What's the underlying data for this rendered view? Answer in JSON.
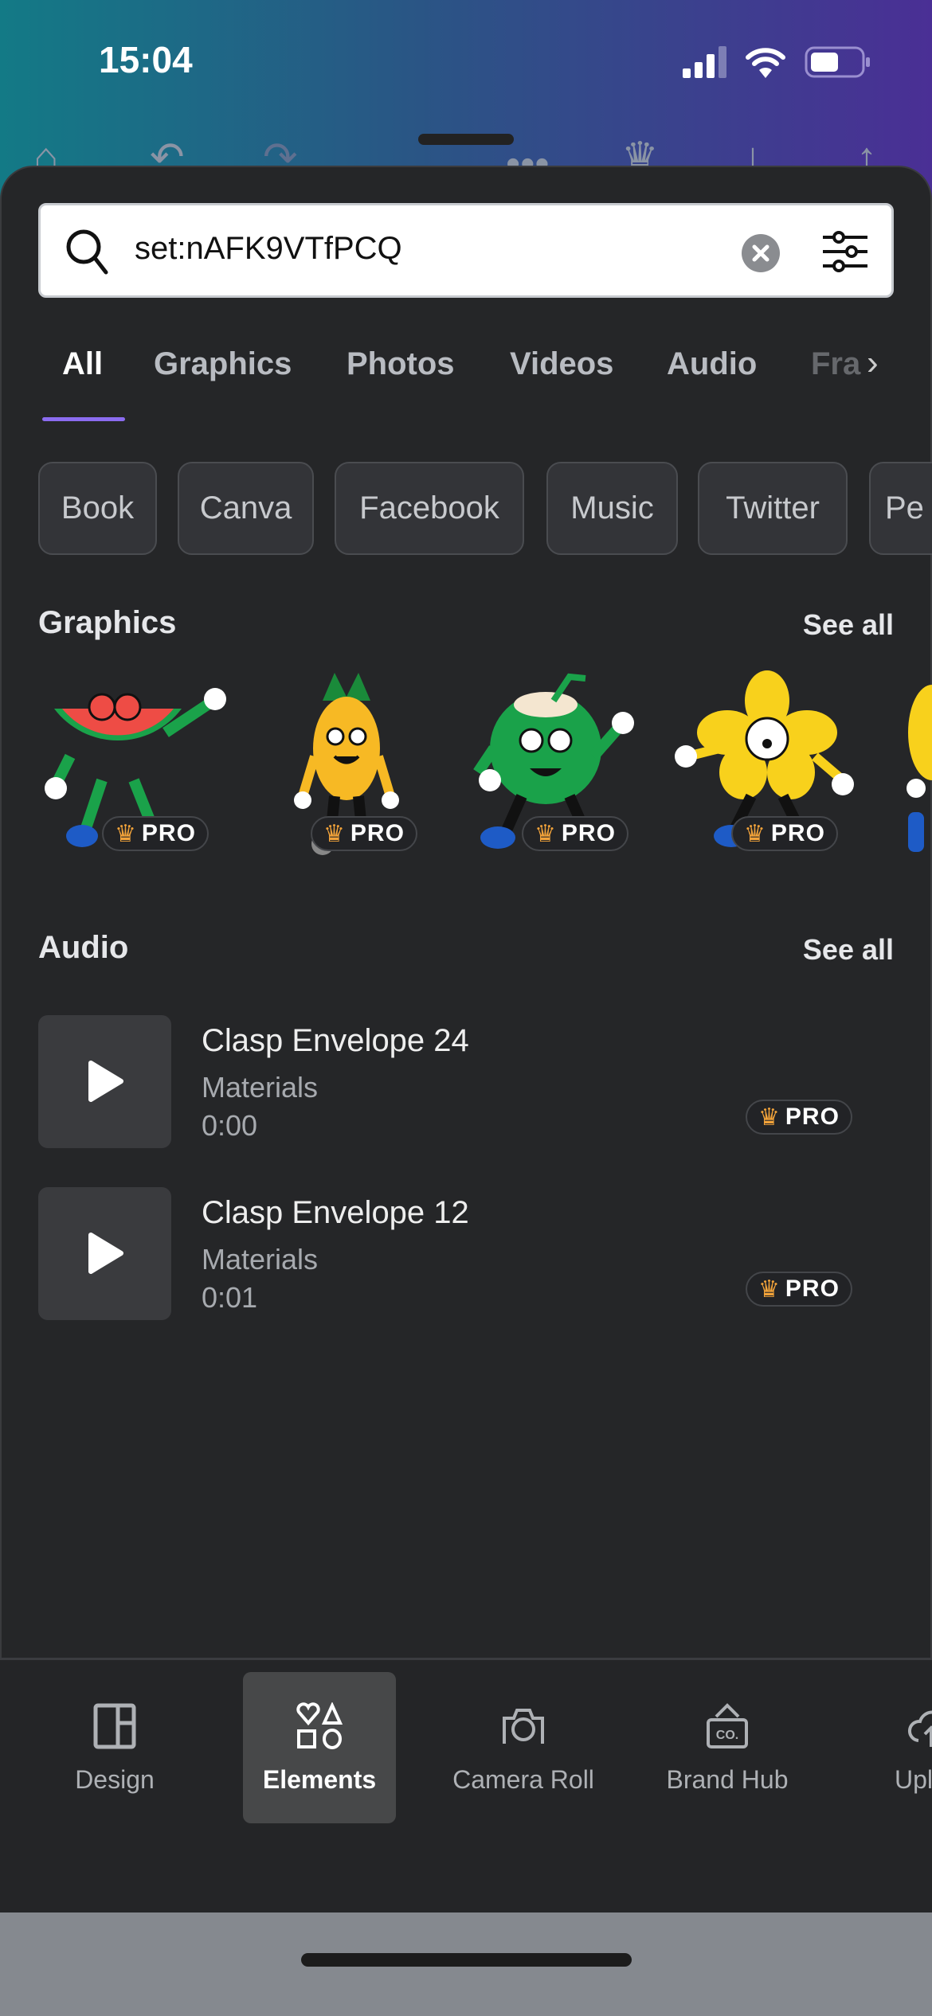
{
  "status": {
    "time": "15:04",
    "battery_level": 0.55
  },
  "search": {
    "value": "set:nAFK9VTfPCQ",
    "icons": [
      "search-icon",
      "clear-icon",
      "filter-icon"
    ]
  },
  "tabs": [
    {
      "label": "All",
      "active": true
    },
    {
      "label": "Graphics"
    },
    {
      "label": "Photos"
    },
    {
      "label": "Videos"
    },
    {
      "label": "Audio"
    },
    {
      "label": "Fra"
    }
  ],
  "chips": [
    "Book",
    "Canva",
    "Facebook",
    "Music",
    "Twitter",
    "Pe"
  ],
  "graphics": {
    "title": "Graphics",
    "see_all": "See all",
    "badge": "PRO",
    "items": [
      "watermelon-character",
      "pineapple-character",
      "coconut-character",
      "flower-character",
      "partial-character"
    ]
  },
  "audio": {
    "title": "Audio",
    "see_all": "See all",
    "items": [
      {
        "title": "Clasp Envelope 24",
        "artist": "Materials",
        "duration": "0:00",
        "badge": "PRO"
      },
      {
        "title": "Clasp Envelope 12",
        "artist": "Materials",
        "duration": "0:01",
        "badge": "PRO"
      }
    ]
  },
  "nav": [
    {
      "label": "Design",
      "icon": "layout-icon"
    },
    {
      "label": "Elements",
      "icon": "shapes-icon",
      "active": true
    },
    {
      "label": "Camera Roll",
      "icon": "camera-icon"
    },
    {
      "label": "Brand Hub",
      "icon": "brand-icon"
    },
    {
      "label": "Uplo",
      "icon": "upload-icon"
    }
  ],
  "colors": {
    "accent": "#8b6cf0",
    "pro_crown": "#f2a33a",
    "sheet_bg": "#252628"
  }
}
